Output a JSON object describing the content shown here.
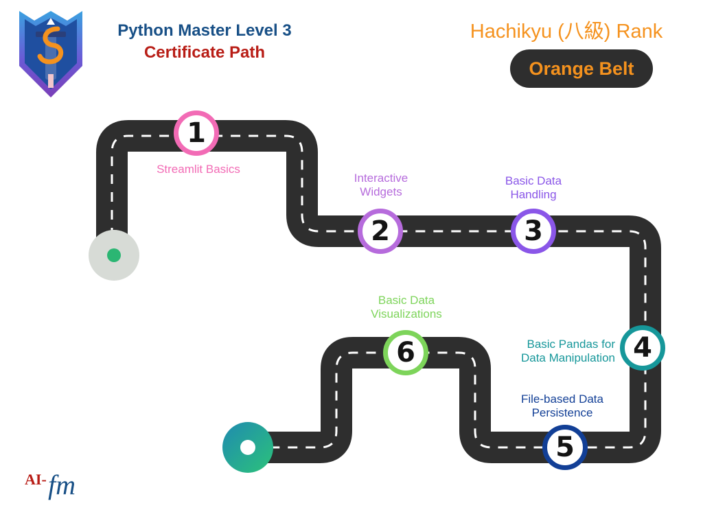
{
  "header": {
    "title": "Python Master Level 3",
    "subtitle": "Certificate Path",
    "rank_title": "Hachikyu (八級) Rank",
    "belt": "Orange Belt"
  },
  "steps": [
    {
      "number": "1",
      "label_lines": [
        "Streamlit Basics"
      ],
      "color": "#f26bb5"
    },
    {
      "number": "2",
      "label_lines": [
        "Interactive",
        "Widgets"
      ],
      "color": "#b66bdc"
    },
    {
      "number": "3",
      "label_lines": [
        "Basic Data",
        "Handling"
      ],
      "color": "#8a56e8"
    },
    {
      "number": "4",
      "label_lines": [
        "Basic Pandas for",
        "Data Manipulation"
      ],
      "color": "#16979a"
    },
    {
      "number": "5",
      "label_lines": [
        "File-based Data",
        "Persistence"
      ],
      "color": "#123f96"
    },
    {
      "number": "6",
      "label_lines": [
        "Basic Data",
        "Visualizations"
      ],
      "color": "#7dd45a"
    }
  ],
  "footer": {
    "brand_prefix": "AI-",
    "brand_suffix": "fm"
  },
  "colors": {
    "title_blue": "#174f86",
    "subtitle_red": "#b81d16",
    "rank_orange": "#f5921e",
    "road": "#2e2e2e",
    "road_dash": "#ffffff",
    "start_point": "#2bb673",
    "end_point_gradient": [
      "#1f8bb0",
      "#2cc27a"
    ]
  },
  "icons": {
    "logo": "shield-crest-icon",
    "start": "start-point-icon",
    "end": "end-point-icon"
  }
}
